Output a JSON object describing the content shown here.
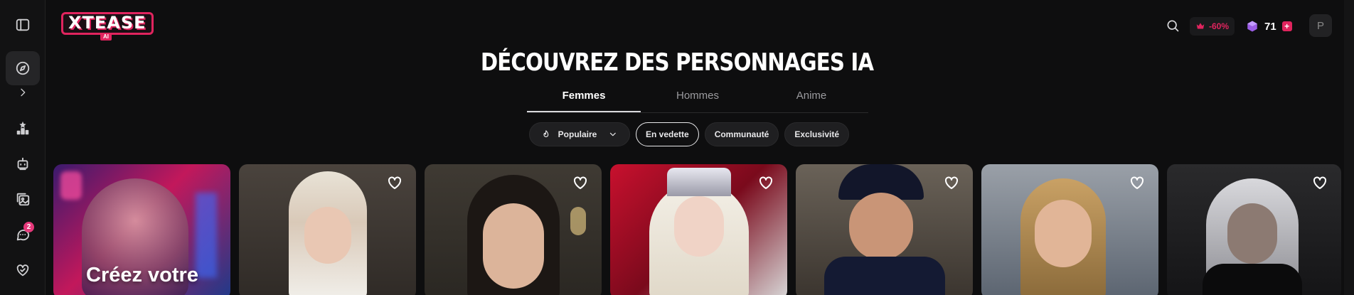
{
  "app": {
    "logo_text": "XTEASE",
    "logo_sub": "AI"
  },
  "sidebar": {
    "items": [
      {
        "name": "toggle-sidebar",
        "icon": "panel-icon"
      },
      {
        "name": "discover",
        "icon": "compass-icon",
        "active": true
      },
      {
        "name": "expand",
        "icon": "chevron-right-icon"
      },
      {
        "name": "ranking",
        "icon": "podium-icon"
      },
      {
        "name": "create",
        "icon": "robot-icon"
      },
      {
        "name": "gallery",
        "icon": "images-icon"
      },
      {
        "name": "chats",
        "icon": "chat-icon",
        "badge": "2"
      },
      {
        "name": "favorites",
        "icon": "heart-hands-icon"
      }
    ]
  },
  "header": {
    "promo_text": "-60%",
    "credits": "71",
    "plus_label": "+",
    "avatar_initial": "P"
  },
  "main": {
    "title": "DÉCOUVREZ DES PERSONNAGES IA",
    "tabs": [
      {
        "label": "Femmes",
        "active": true
      },
      {
        "label": "Hommes",
        "active": false
      },
      {
        "label": "Anime",
        "active": false
      }
    ],
    "sort": {
      "label": "Populaire"
    },
    "filters": [
      {
        "label": "En vedette",
        "active": true
      },
      {
        "label": "Communauté",
        "active": false
      },
      {
        "label": "Exclusivité",
        "active": false
      }
    ],
    "create_card": {
      "label": "Créez votre"
    }
  },
  "colors": {
    "accent": "#e0245e",
    "background": "#0e0e0f",
    "sidebar": "#121213"
  }
}
